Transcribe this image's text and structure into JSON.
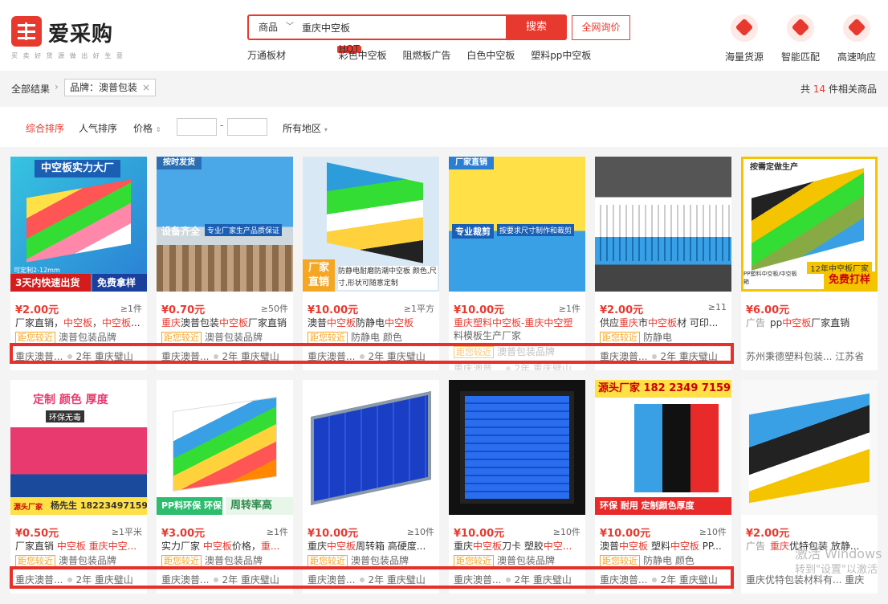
{
  "header": {
    "logo_text": "爱采购",
    "slogan": "买 卖 好 货 源   做 出 好 生 意",
    "search_category": "商品",
    "search_value": "重庆中空板",
    "search_button": "搜索",
    "inquiry_button": "全网询价",
    "hot_words": [
      "万通板材",
      "彩色中空板",
      "阻燃板广告",
      "白色中空板",
      "塑料pp中空板"
    ],
    "hot_badge": "HOT",
    "features": [
      "海量货源",
      "智能匹配",
      "高速响应"
    ]
  },
  "breadcrumb": {
    "all": "全部结果",
    "tag": "品牌：澳普包装",
    "result_prefix": "共",
    "result_count": "14",
    "result_suffix": "件相关商品"
  },
  "sort": {
    "default": "综合排序",
    "popularity": "人气排序",
    "price": "价格",
    "region": "所有地区"
  },
  "products": [
    {
      "price": "¥2.00元",
      "moq": "≥1件",
      "title_parts": [
        "厂家直销，",
        "中空板",
        "，",
        "中空板",
        "..."
      ],
      "tag_near": "距您较近",
      "tag_text": "澳普包装品牌",
      "shop": "重庆澳普...",
      "years": "2年",
      "city": "重庆璧山",
      "img_top": "中空板实力大厂",
      "img_bottom": "3天内快速出货",
      "img_extra": "免费拿样",
      "img_small": "可定制2-12mm"
    },
    {
      "price": "¥0.70元",
      "moq": "≥50件",
      "title_parts": [
        "重庆",
        "澳普包装",
        "中空板",
        "厂家直销"
      ],
      "tag_near": "距您较近",
      "tag_text": "澳普包装品牌",
      "shop": "重庆澳普...",
      "years": "2年",
      "city": "重庆璧山",
      "img_top": "按时发货",
      "img_bottom": "设备齐全",
      "img_extra": "专业厂家生产品质保证"
    },
    {
      "price": "¥10.00元",
      "moq": "≥1平方",
      "title_parts": [
        "澳普",
        "中空板",
        "防静电",
        "中空板",
        ""
      ],
      "tag_near": "距您较近",
      "tag_text": "防静电  颜色",
      "shop": "重庆澳普...",
      "years": "2年",
      "city": "重庆璧山",
      "img_top": "",
      "img_bottom": "厂家直销",
      "img_extra": "防静电耐磨防潮中空板 颜色,尺寸,形状可随意定制"
    },
    {
      "price": "¥10.00元",
      "moq": "≥1件",
      "title_parts": [
        "重庆",
        "塑料中空板",
        "-重庆",
        "中空塑"
      ],
      "title2": "料模板生产厂家",
      "tag_near": "距您较近",
      "tag_text": "澳普包装品牌",
      "shop": "重庆澳普...",
      "years": "2年",
      "city": "重庆璧山",
      "img_top": "厂家直销",
      "img_bottom": "专业裁剪",
      "img_extra": "按要求尺寸制作和裁剪"
    },
    {
      "price": "¥2.00元",
      "moq": "≥11",
      "title_parts": [
        "供应",
        "重庆",
        "市",
        "中空板",
        "材 可印..."
      ],
      "tag_near": "距您较近",
      "tag_text": "防静电",
      "shop": "重庆澳普...",
      "years": "2年",
      "city": "重庆璧山",
      "img_top": "",
      "img_bottom": "",
      "img_extra": ""
    },
    {
      "price": "¥6.00元",
      "moq": "",
      "ad": "广告",
      "title_parts": [
        "pp",
        "中空板",
        "厂家直销"
      ],
      "tag_near": "",
      "tag_text": "",
      "shop": "苏州秉德塑料包装...",
      "years": "",
      "city": "江苏省",
      "img_top": "按需定做生产",
      "img_bottom": "免费打样",
      "img_extra": "12年中空板厂家",
      "img_small": "PP塑料中空板/中空板箱"
    },
    {
      "price": "¥0.50元",
      "moq": "≥1平米",
      "title_parts": [
        "厂家直销 ",
        "中空板",
        " ",
        "重庆中空..."
      ],
      "tag_near": "距您较近",
      "tag_text": "澳普包装品牌",
      "shop": "重庆澳普...",
      "years": "2年",
      "city": "重庆璧山",
      "img_top": "定制 颜色 厚度",
      "img_bottom": "杨先生 18223497159",
      "img_extra": "环保无毒",
      "img_small": "源头厂家"
    },
    {
      "price": "¥3.00元",
      "moq": "≥1件",
      "title_parts": [
        "实力厂家 ",
        "中空板",
        "价格，",
        "重..."
      ],
      "tag_near": "距您较近",
      "tag_text": "澳普包装品牌",
      "shop": "重庆澳普...",
      "years": "2年",
      "city": "重庆璧山",
      "img_top": "",
      "img_bottom": "PP料环保 环保",
      "img_extra": "周转率高"
    },
    {
      "price": "¥10.00元",
      "moq": "≥10件",
      "title_parts": [
        "重庆",
        "中空板",
        "周转箱 高硬度..."
      ],
      "tag_near": "距您较近",
      "tag_text": "澳普包装品牌",
      "shop": "重庆澳普...",
      "years": "2年",
      "city": "重庆璧山",
      "img_top": "",
      "img_bottom": "",
      "img_extra": ""
    },
    {
      "price": "¥10.00元",
      "moq": "≥10件",
      "title_parts": [
        "重庆",
        "中空板",
        "刀卡 塑胶",
        "中空..."
      ],
      "tag_near": "距您较近",
      "tag_text": "澳普包装品牌",
      "shop": "重庆澳普...",
      "years": "2年",
      "city": "重庆璧山",
      "img_top": "",
      "img_bottom": "",
      "img_extra": ""
    },
    {
      "price": "¥10.00元",
      "moq": "≥10件",
      "title_parts": [
        "澳普",
        "中空板",
        " 塑料",
        "中空板",
        " PP..."
      ],
      "tag_near": "距您较近",
      "tag_text": "防静电  颜色",
      "shop": "重庆澳普...",
      "years": "2年",
      "city": "重庆璧山",
      "img_top": "源头厂家 182 2349 7159",
      "img_bottom": "环保 耐用 定制颜色厚度",
      "img_extra": ""
    },
    {
      "price": "¥2.00元",
      "moq": "",
      "ad": "广告",
      "title_parts": [
        "重庆",
        "优特包装 ",
        "放静..."
      ],
      "tag_near": "",
      "tag_text": "",
      "shop": "重庆优特包装材料有...",
      "years": "",
      "city": "重庆",
      "img_top": "",
      "img_bottom": "",
      "img_extra": ""
    }
  ],
  "overlay": {
    "activate_windows": "激活 Windows",
    "activate_hint": "转到\"设置\"以激活"
  }
}
